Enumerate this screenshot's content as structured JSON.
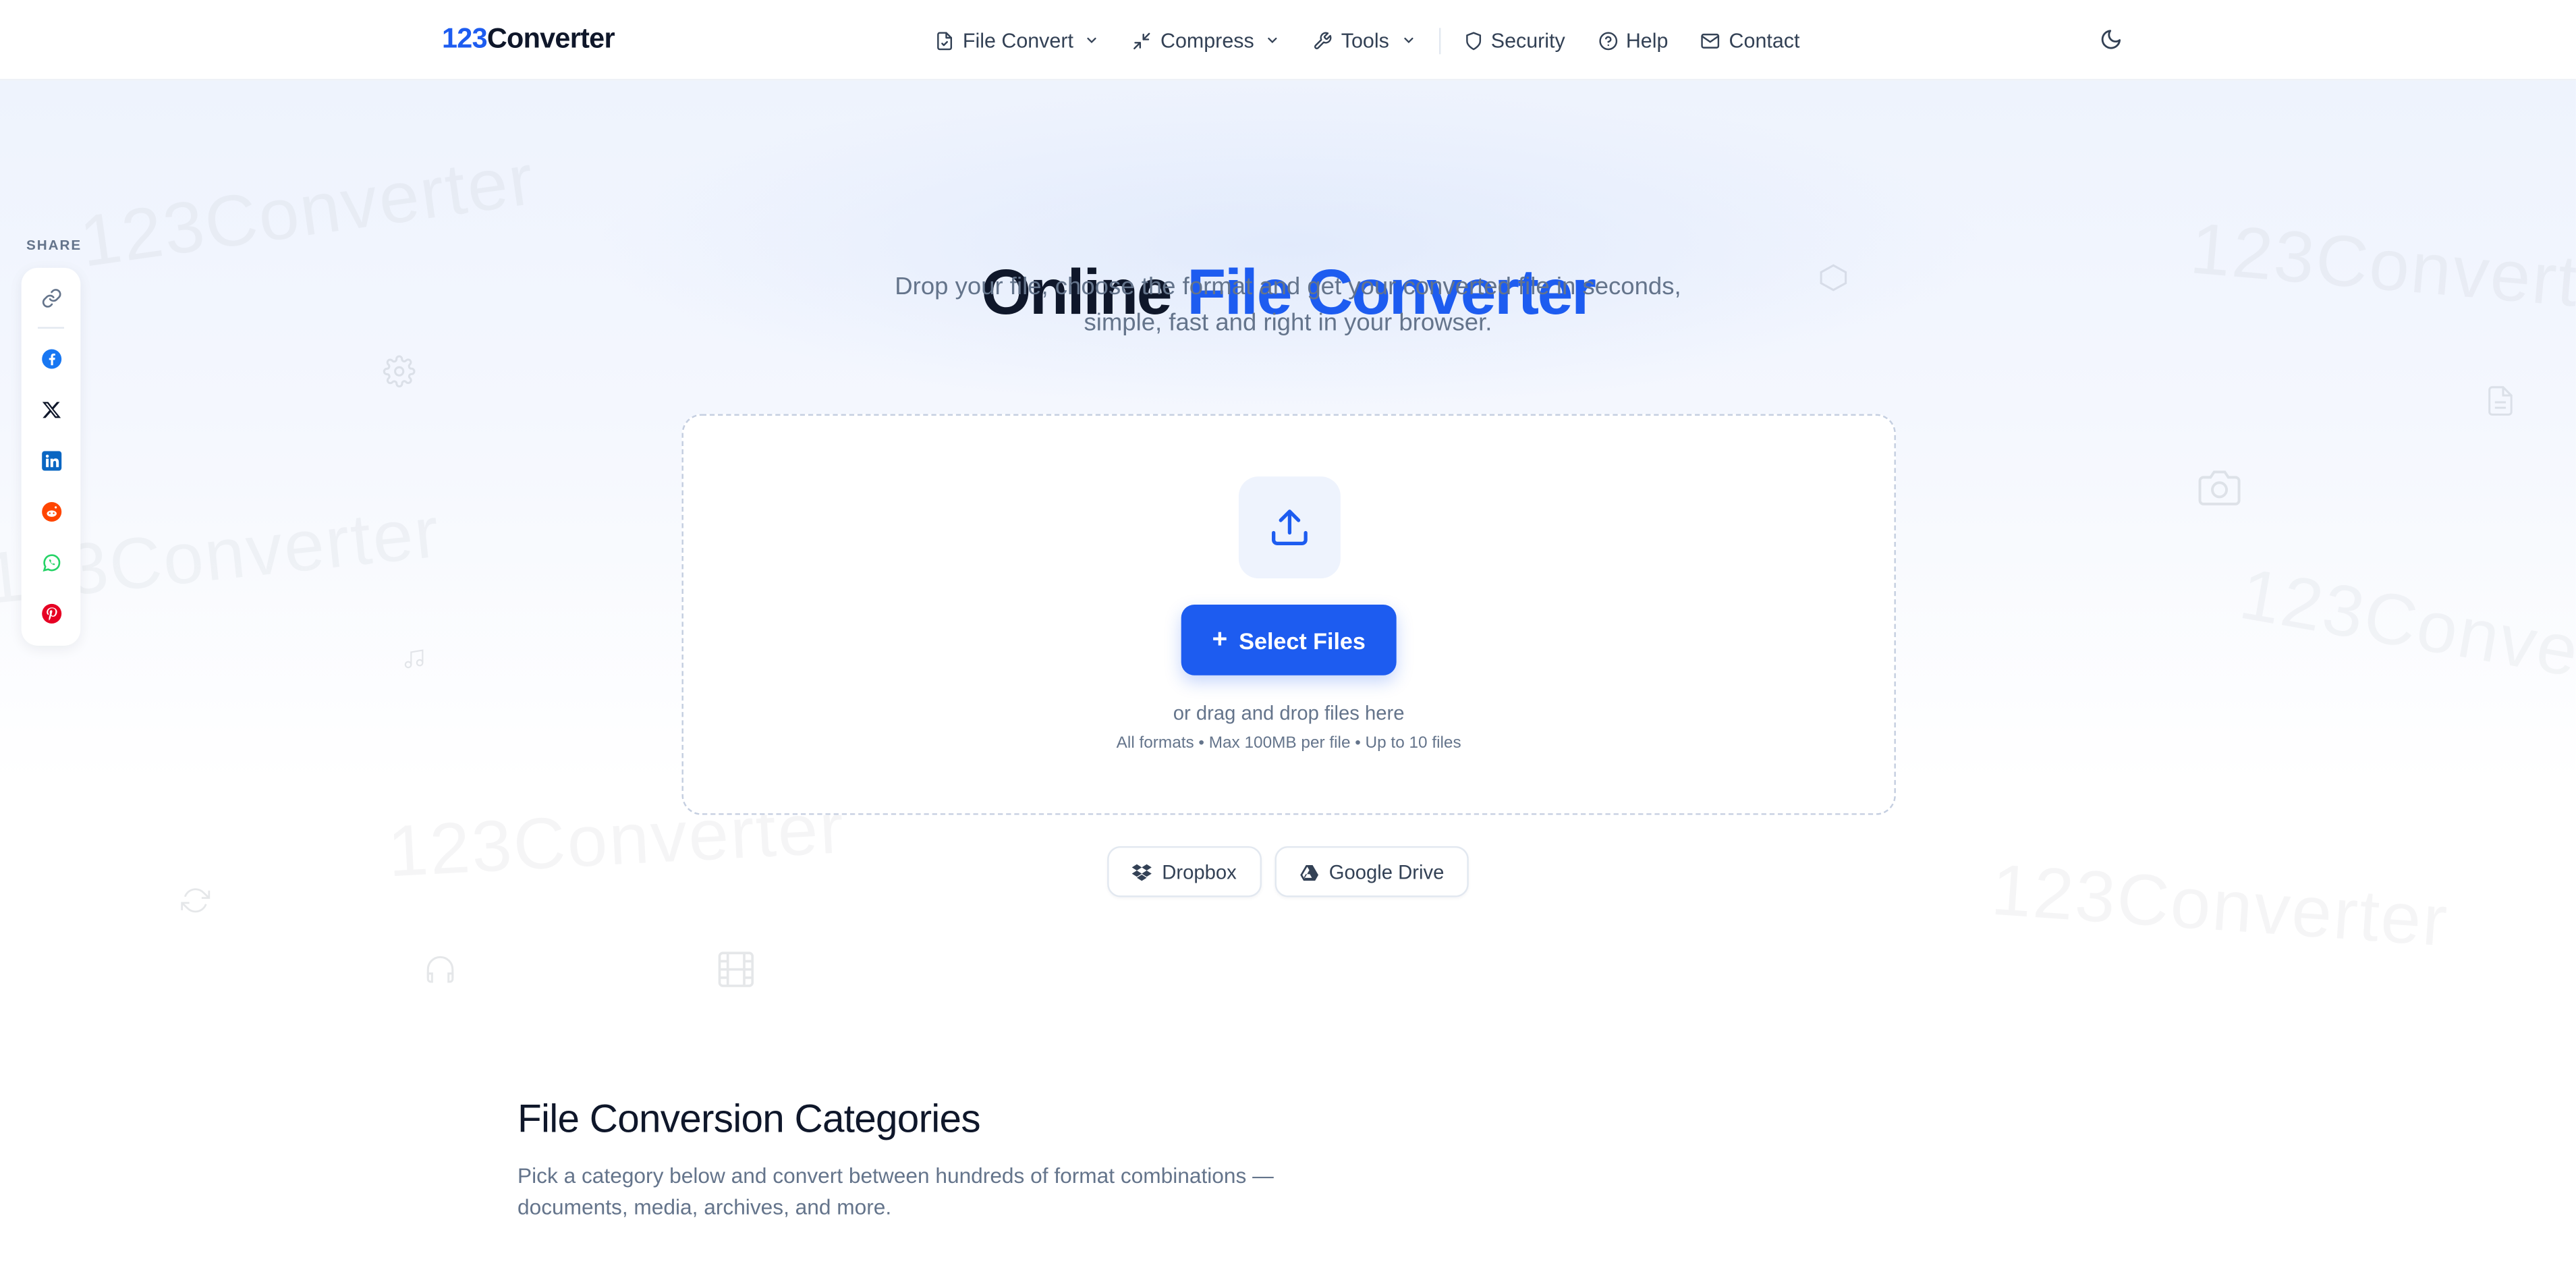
{
  "header": {
    "logo_num": "123",
    "logo_text": "Converter",
    "nav": [
      {
        "label": "File Convert",
        "icon": "file-icon",
        "dropdown": true
      },
      {
        "label": "Compress",
        "icon": "compress-icon",
        "dropdown": true
      },
      {
        "label": "Tools",
        "icon": "wrench-icon",
        "dropdown": true
      },
      {
        "label": "Security",
        "icon": "shield-icon",
        "dropdown": false
      },
      {
        "label": "Help",
        "icon": "help-circle-icon",
        "dropdown": false
      },
      {
        "label": "Contact",
        "icon": "mail-icon",
        "dropdown": false
      }
    ],
    "theme_toggle_icon": "moon-icon"
  },
  "hero": {
    "title_part1": "Online",
    "title_part2": "File Converter",
    "subtitle": "Drop your file, choose the format and get your converted file in seconds, simple, fast and right in your browser.",
    "watermark_text": "123Converter"
  },
  "dropzone": {
    "upload_icon": "upload-icon",
    "select_label": "Select Files",
    "drag_text": "or drag and drop files here",
    "meta_text": "All formats • Max 100MB per file • Up to 10 files"
  },
  "cloud": {
    "dropbox_label": "Dropbox",
    "gdrive_label": "Google Drive"
  },
  "share": {
    "label": "SHARE",
    "items": [
      "link-icon",
      "facebook-icon",
      "x-icon",
      "linkedin-icon",
      "reddit-icon",
      "whatsapp-icon",
      "pinterest-icon"
    ]
  },
  "categories": {
    "title": "File Conversion Categories",
    "subtitle": "Pick a category below and convert between hundreds of format combinations — documents, media, archives, and more."
  },
  "colors": {
    "accent": "#1d5cf0",
    "text": "#0f172a",
    "muted": "#64748b"
  }
}
